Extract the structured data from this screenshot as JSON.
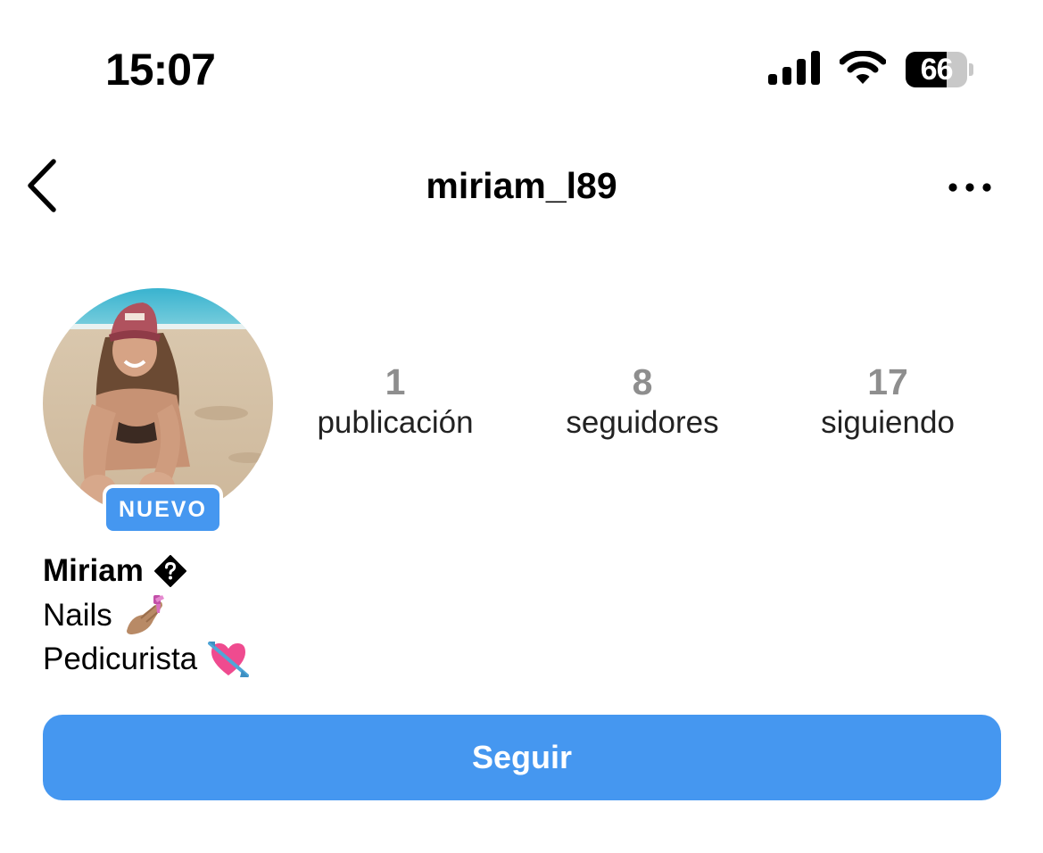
{
  "status_bar": {
    "time": "15:07",
    "battery_level": "66",
    "battery_fraction": 0.66,
    "icons": [
      "signal-icon",
      "wifi-icon",
      "battery-icon"
    ]
  },
  "header": {
    "username": "miriam_l89",
    "back_icon": "chevron-left-icon",
    "more_icon": "more-horizontal-icon"
  },
  "profile": {
    "new_badge": "NUEVO",
    "name": "Miriam",
    "name_symbol_icon": "diamond-question-icon",
    "bio": [
      {
        "text": "Nails",
        "emoji_icon": "nail-polish-emoji-icon"
      },
      {
        "text": "Pedicurista",
        "emoji_icon": "heart-with-arrow-emoji-icon"
      }
    ]
  },
  "stats": {
    "posts": {
      "count": "1",
      "label": "publicación"
    },
    "followers": {
      "count": "8",
      "label": "seguidores"
    },
    "following": {
      "count": "17",
      "label": "siguiendo"
    }
  },
  "actions": {
    "follow_label": "Seguir"
  },
  "colors": {
    "accent": "#4597f0",
    "stat_count": "#8e8e8e",
    "text": "#000000",
    "background": "#ffffff"
  }
}
